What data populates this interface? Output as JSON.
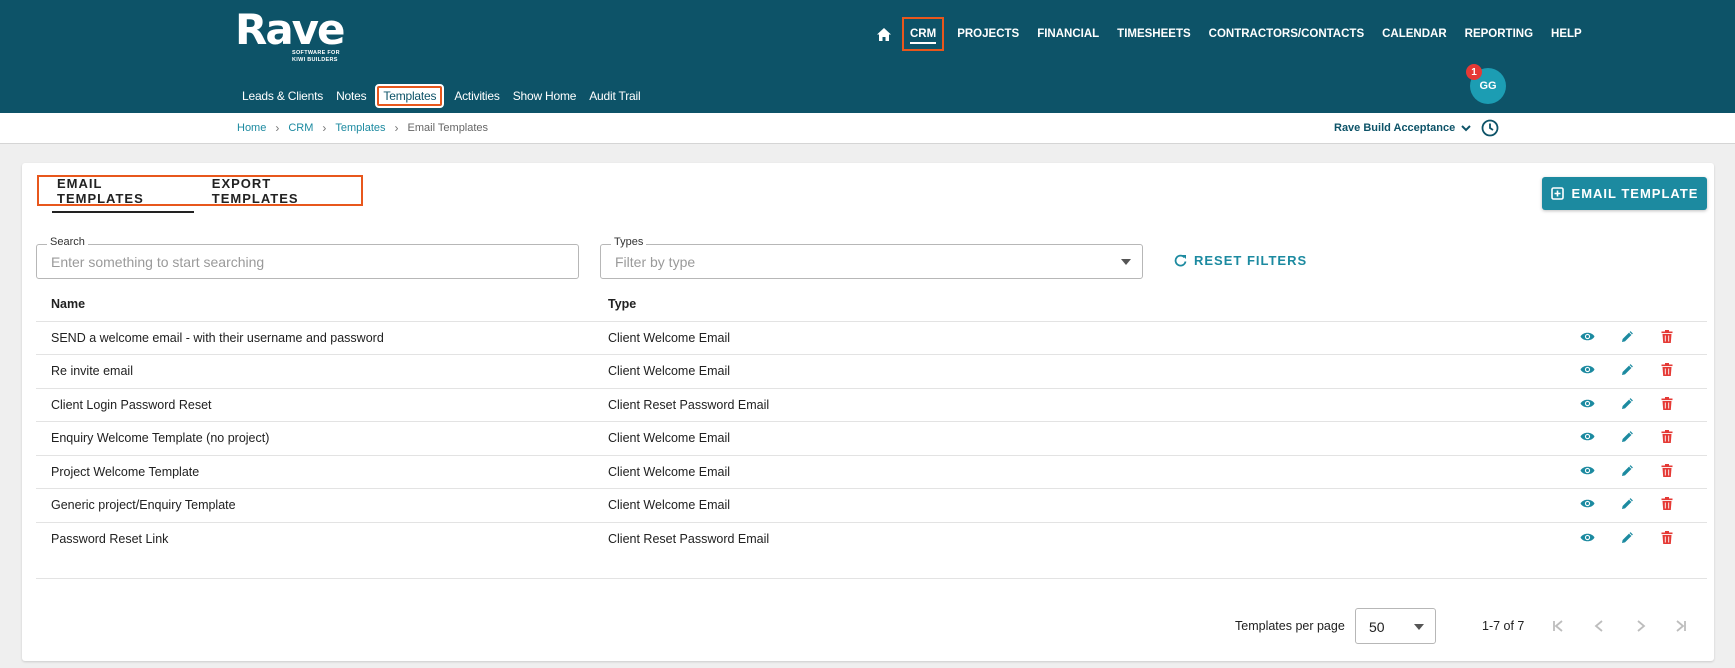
{
  "header": {
    "logo_word": "Rave",
    "logo_tagline": "SOFTWARE FOR\nKIWI BUILDERS",
    "home_icon": "home-icon",
    "nav": [
      "CRM",
      "PROJECTS",
      "FINANCIAL",
      "TIMESHEETS",
      "CONTRACTORS/CONTACTS",
      "CALENDAR",
      "REPORTING",
      "HELP"
    ],
    "active_nav": "CRM",
    "subnav": [
      "Leads & Clients",
      "Notes",
      "Templates",
      "Activities",
      "Show Home",
      "Audit Trail"
    ],
    "active_subnav": "Templates",
    "avatar_initials": "GG",
    "notification_count": "1"
  },
  "breadcrumb": [
    "Home",
    "CRM",
    "Templates",
    "Email Templates"
  ],
  "project_selector": "Rave Build Acceptance",
  "tabs": [
    "EMAIL TEMPLATES",
    "EXPORT TEMPLATES"
  ],
  "add_button_label": "EMAIL TEMPLATE",
  "filters": {
    "search_label": "Search",
    "search_placeholder": "Enter something to start searching",
    "types_label": "Types",
    "types_placeholder": "Filter by type",
    "reset_label": "RESET FILTERS"
  },
  "table": {
    "columns": [
      "Name",
      "Type"
    ],
    "rows": [
      {
        "name": "SEND a welcome email - with their username and password",
        "type": "Client Welcome Email"
      },
      {
        "name": "Re invite email",
        "type": "Client Welcome Email"
      },
      {
        "name": "Client Login Password Reset",
        "type": "Client Reset Password Email"
      },
      {
        "name": "Enquiry Welcome Template (no project)",
        "type": "Client Welcome Email"
      },
      {
        "name": "Project Welcome Template",
        "type": "Client Welcome Email"
      },
      {
        "name": "Generic project/Enquiry Template",
        "type": "Client Welcome Email"
      },
      {
        "name": "Password Reset Link",
        "type": "Client Reset Password Email"
      }
    ]
  },
  "pagination": {
    "per_page_label": "Templates per page",
    "per_page_value": "50",
    "range": "1-7 of 7"
  },
  "colors": {
    "brand": "#0d5368",
    "accent": "#1c8aa0",
    "highlight": "#e8571c",
    "danger": "#e53935"
  }
}
